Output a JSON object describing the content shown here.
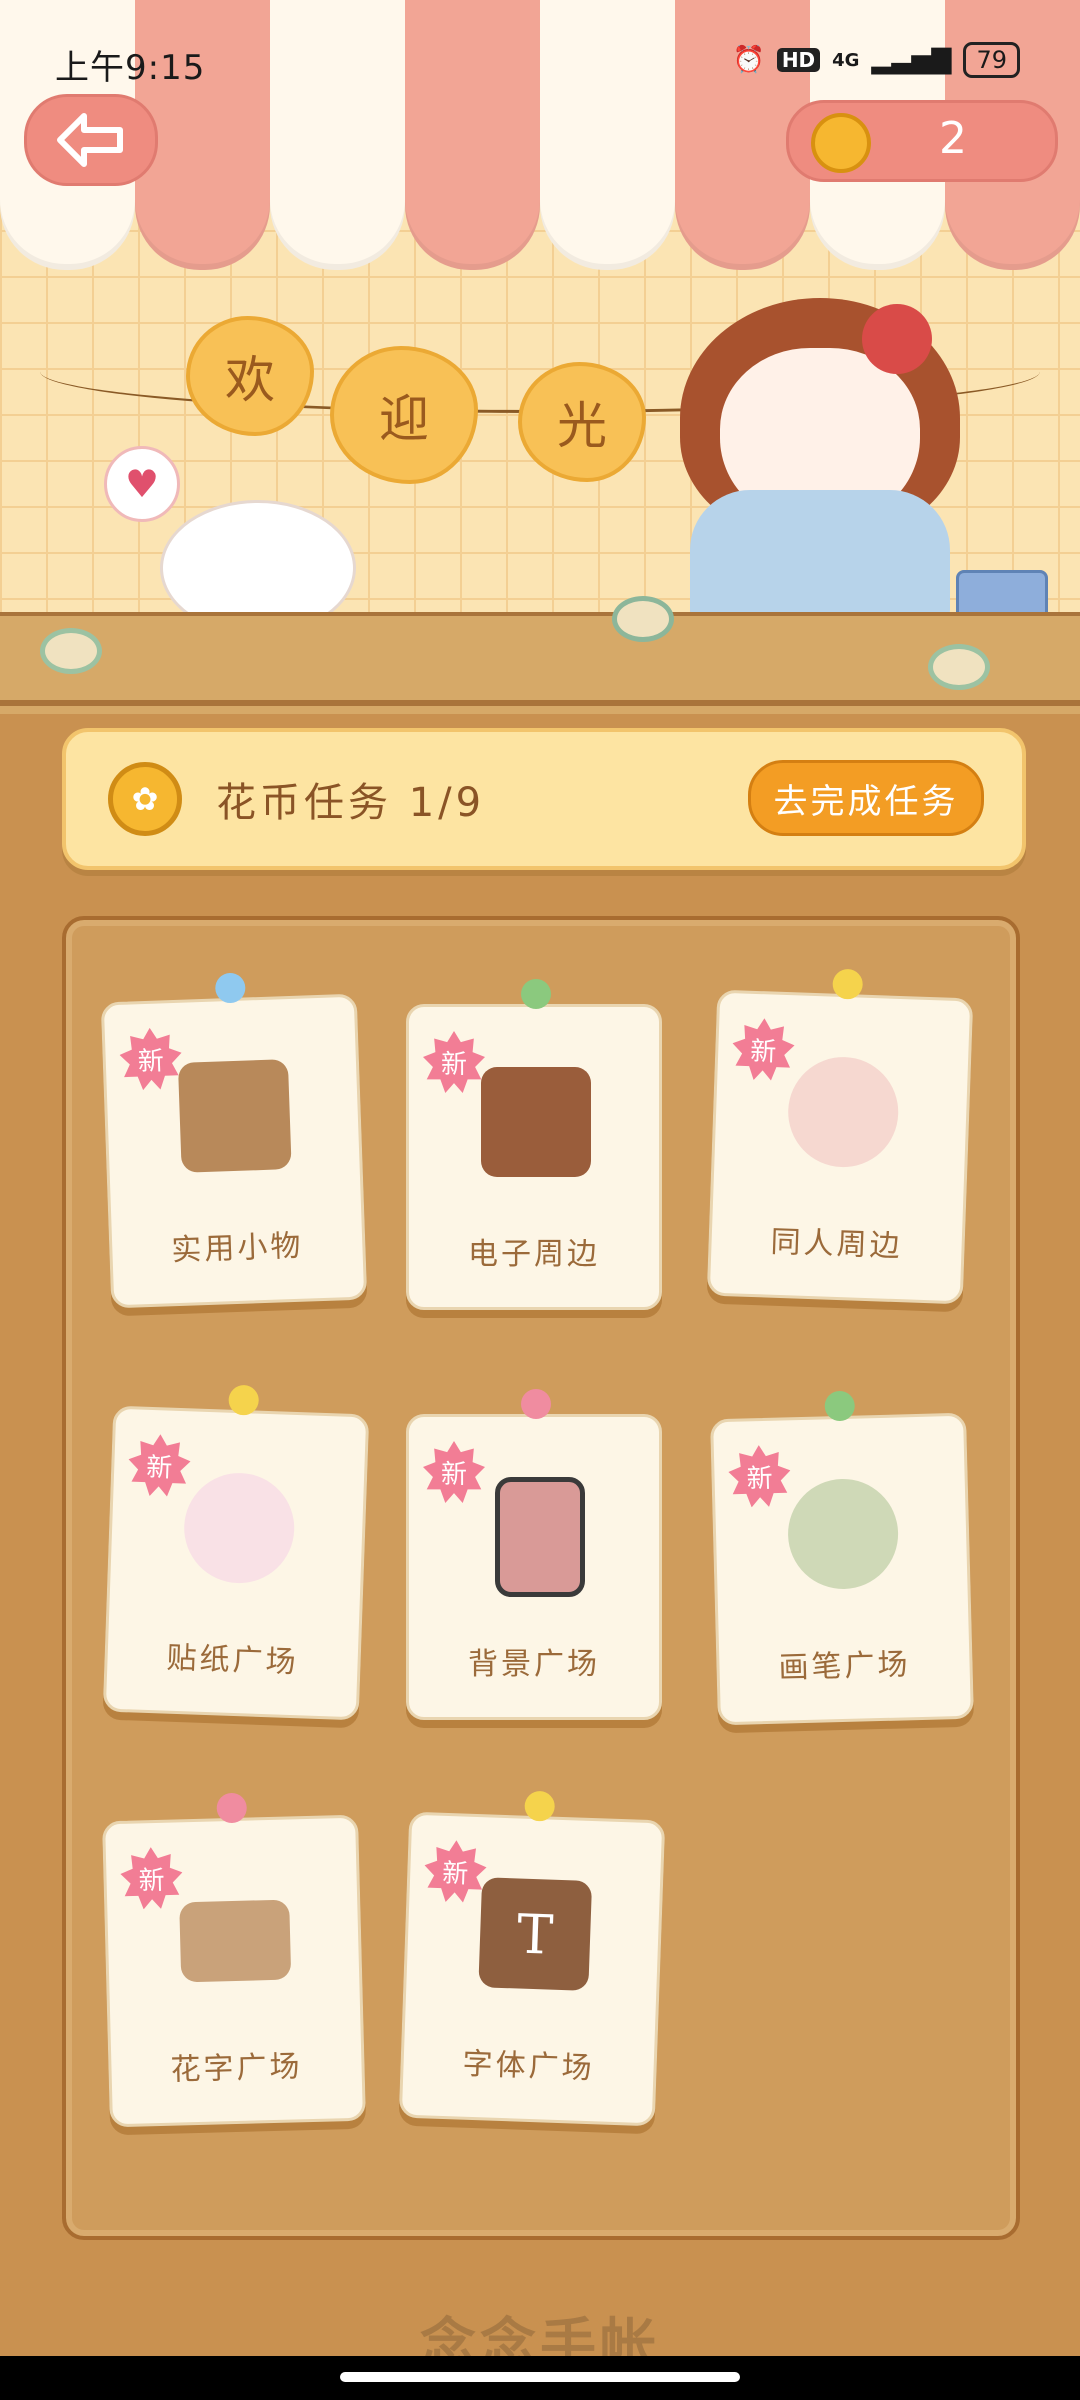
{
  "status_bar": {
    "time": "上午9:15",
    "network": "4G",
    "hd": "HD",
    "battery": "79"
  },
  "header": {
    "coin_count": "2",
    "welcome_chars": [
      "欢",
      "迎",
      "光"
    ]
  },
  "task": {
    "label": "花币任务 1/9",
    "button": "去完成任务"
  },
  "categories": [
    {
      "label": "实用小物",
      "badge": "新",
      "pin_color": "#8fc9ef",
      "art_color": "#b8895a"
    },
    {
      "label": "电子周边",
      "badge": "新",
      "pin_color": "#8bc97e",
      "art_color": "#9a5d3b"
    },
    {
      "label": "同人周边",
      "badge": "新",
      "pin_color": "#f5d34c",
      "art_color": "#f6d8d0"
    },
    {
      "label": "贴纸广场",
      "badge": "新",
      "pin_color": "#f5d34c",
      "art_color": "#f9e1e6"
    },
    {
      "label": "背景广场",
      "badge": "新",
      "pin_color": "#f08ca0",
      "art_color": "#d99a97"
    },
    {
      "label": "画笔广场",
      "badge": "新",
      "pin_color": "#8bc97e",
      "art_color": "#cfd9b7"
    },
    {
      "label": "花字广场",
      "badge": "新",
      "pin_color": "#f08ca0",
      "art_color": "#c9a27a"
    },
    {
      "label": "字体广场",
      "badge": "新",
      "pin_color": "#f5d34c",
      "art_color": "#8e5f3f"
    }
  ],
  "footer": {
    "text": "念念手帐"
  },
  "colors": {
    "awning_pink": "#f2a595",
    "board": "#cf9c5c",
    "task_button": "#f39d24",
    "badge": "#f27d95"
  }
}
